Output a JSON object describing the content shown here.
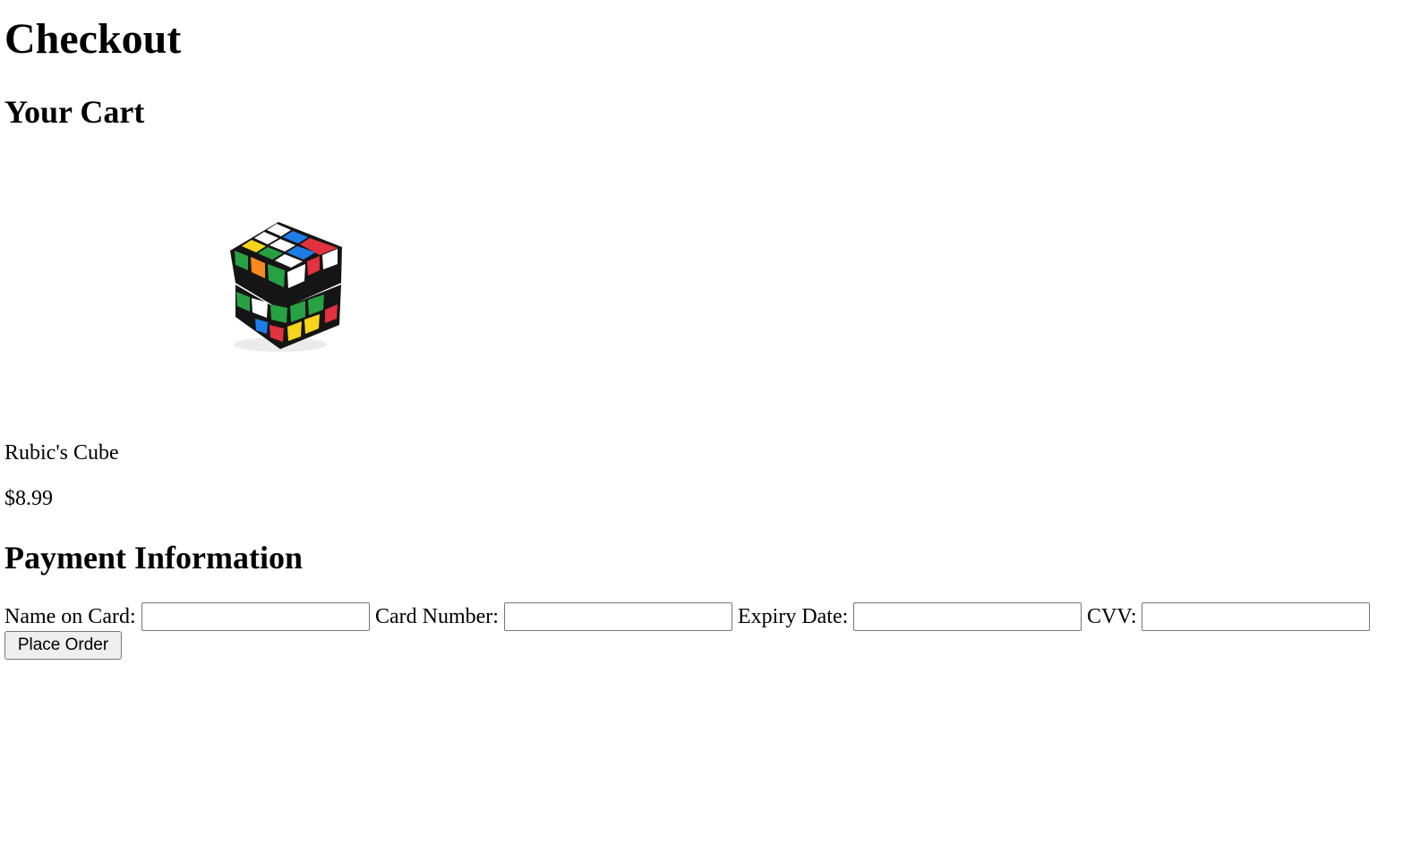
{
  "page": {
    "title": "Checkout"
  },
  "cart": {
    "heading": "Your Cart",
    "items": [
      {
        "name": "Rubic's Cube",
        "price": "$8.99",
        "image_icon": "rubiks-cube-icon"
      }
    ]
  },
  "payment": {
    "heading": "Payment Information",
    "fields": [
      {
        "label": "Name on Card:",
        "value": "",
        "placeholder": ""
      },
      {
        "label": "Card Number:",
        "value": "",
        "placeholder": ""
      },
      {
        "label": "Expiry Date:",
        "value": "",
        "placeholder": ""
      },
      {
        "label": "CVV:",
        "value": "",
        "placeholder": ""
      }
    ],
    "submit_label": "Place Order"
  },
  "colors": {
    "cube_white": "#ffffff",
    "cube_blue": "#1e7ee8",
    "cube_red": "#e2313f",
    "cube_orange": "#f78a1d",
    "cube_green": "#27a144",
    "cube_yellow": "#f7d51d",
    "cube_body": "#151515"
  }
}
